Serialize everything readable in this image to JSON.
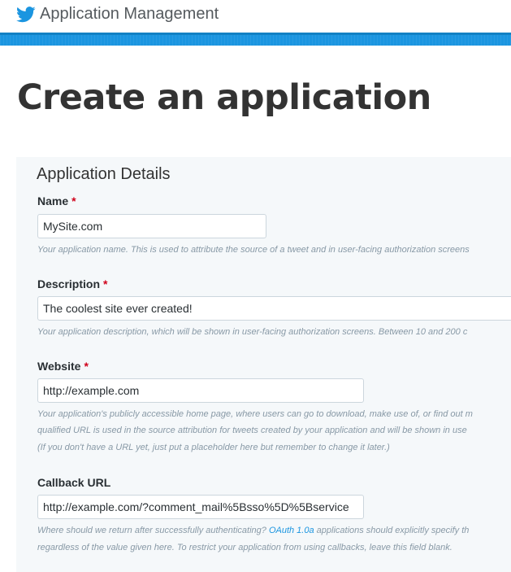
{
  "app": {
    "title": "Application Management"
  },
  "page": {
    "title": "Create an application"
  },
  "panel": {
    "title": "Application Details"
  },
  "fields": {
    "name": {
      "label": "Name",
      "required_mark": "*",
      "value": "MySite.com",
      "help": "Your application name. This is used to attribute the source of a tweet and in user-facing authorization screens"
    },
    "description": {
      "label": "Description",
      "required_mark": "*",
      "value": "The coolest site ever created!",
      "help": "Your application description, which will be shown in user-facing authorization screens. Between 10 and 200 c"
    },
    "website": {
      "label": "Website",
      "required_mark": "*",
      "value": "http://example.com",
      "help_line1": "Your application's publicly accessible home page, where users can go to download, make use of, or find out m",
      "help_line2": "qualified URL is used in the source attribution for tweets created by your application and will be shown in use",
      "help_line3": "(If you don't have a URL yet, just put a placeholder here but remember to change it later.)"
    },
    "callback": {
      "label": "Callback URL",
      "value": "http://example.com/?comment_mail%5Bsso%5D%5Bservice",
      "help_line1_pre": "Where should we return after successfully authenticating?",
      "help_link": "OAuth 1.0a",
      "help_line1_post": "applications should explicitly specify th",
      "help_line2": "regardless of the value given here. To restrict your application from using callbacks, leave this field blank."
    }
  },
  "colors": {
    "brand_blue": "#1b95e0",
    "required_red": "#d0021b"
  },
  "icons": {
    "brand": "twitter-bird-icon"
  }
}
